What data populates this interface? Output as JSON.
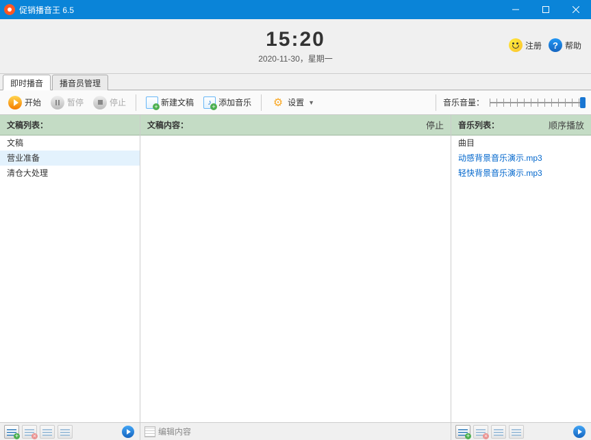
{
  "app": {
    "title": "促销播音王 6.5"
  },
  "header": {
    "time": "15:20",
    "date": "2020-11-30，星期一",
    "register": "注册",
    "help": "帮助"
  },
  "tabs": [
    {
      "label": "即时播音",
      "active": true
    },
    {
      "label": "播音员管理",
      "active": false
    }
  ],
  "toolbar": {
    "start": "开始",
    "pause": "暂停",
    "stop": "停止",
    "new_doc": "新建文稿",
    "add_music": "添加音乐",
    "settings": "设置",
    "music_volume": "音乐音量："
  },
  "panels": {
    "doclist": {
      "title": "文稿列表：",
      "items": [
        "文稿",
        "营业准备",
        "清仓大处理"
      ],
      "selected_index": 1
    },
    "doccontent": {
      "title": "文稿内容：",
      "status": "停止"
    },
    "musiclist": {
      "title": "音乐列表：",
      "mode": "顺序播放",
      "header": "曲目",
      "items": [
        "动感背景音乐演示.mp3",
        "轻快背景音乐演示.mp3"
      ]
    }
  },
  "bottom": {
    "edit_label": "编辑内容"
  }
}
